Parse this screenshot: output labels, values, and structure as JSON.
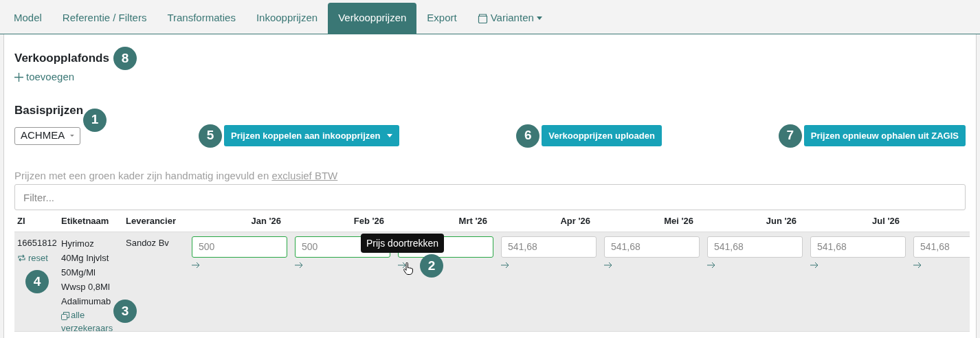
{
  "tabs": [
    {
      "label": "Model",
      "selected": false
    },
    {
      "label": "Referentie / Filters",
      "selected": false
    },
    {
      "label": "Transformaties",
      "selected": false
    },
    {
      "label": "Inkoopprijzen",
      "selected": false
    },
    {
      "label": "Verkoopprijzen",
      "selected": true
    },
    {
      "label": "Export",
      "selected": false
    },
    {
      "label": "Varianten",
      "selected": false,
      "kind": "dropdown"
    }
  ],
  "ceilings": {
    "title": "Verkoopplafonds",
    "badge": "8",
    "add_link": "toevoegen"
  },
  "base_prices": {
    "title": "Basisprijzen",
    "badge": "1",
    "insurer_select": "ACHMEA",
    "buttons": [
      {
        "label": "Prijzen koppelen aan inkoopprijzen",
        "badge": "5",
        "dropdown": true
      },
      {
        "label": "Verkoopprijzen uploaden",
        "badge": "6",
        "dropdown": false
      },
      {
        "label": "Prijzen opnieuw ophalen uit ZAGIS",
        "badge": "7",
        "dropdown": false
      }
    ],
    "note": "Prijzen met een groen kader zijn handmatig ingevuld en ",
    "note_link": "exclusief BTW",
    "filter_placeholder": "Filter..."
  },
  "table": {
    "columns": [
      "ZI",
      "Etiketnaam",
      "Leverancier"
    ],
    "months": [
      "Jan '26",
      "Feb '26",
      "Mrt '26",
      "Apr '26",
      "Mei '26",
      "Jun '26",
      "Jul '26"
    ],
    "rows": [
      {
        "zi": "16651812",
        "reset": "reset",
        "reset_badge": "4",
        "name": "Hyrimoz 40Mg Injvlst 50Mg/Ml Wwsp 0,8Ml Adalimumab",
        "all_link": "alle verzekeraars",
        "all_badge": "3",
        "supplier": "Sandoz Bv",
        "prices": [
          {
            "value": "500",
            "manual": true
          },
          {
            "value": "500",
            "manual": true
          },
          {
            "manual": true
          },
          {
            "value": "541,68",
            "manual": false
          },
          {
            "value": "541,68",
            "manual": false
          },
          {
            "value": "541,68",
            "manual": false
          },
          {
            "value": "541,68",
            "manual": false
          },
          {
            "value": "541,68",
            "manual": false
          }
        ]
      }
    ]
  },
  "tooltip": {
    "text": "Prijs doortrekken",
    "badge": "2"
  }
}
